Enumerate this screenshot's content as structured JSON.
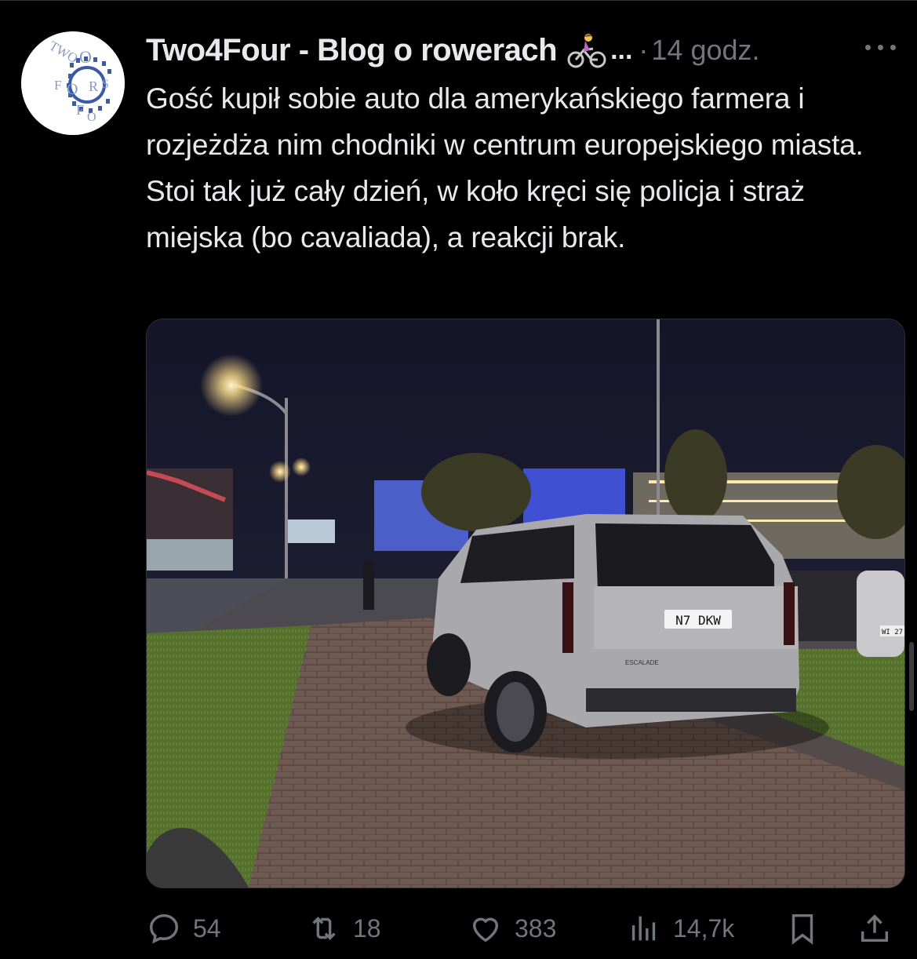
{
  "tweet": {
    "author_name": "Two4Four - Blog o rowerach",
    "ellipsis": "...",
    "separator": "·",
    "time": "14 godz.",
    "text": "Gość kupił sobie auto dla amerykańskiego farmera i rozjeżdża nim chodniki w centrum europejskiego miasta. Stoi tak już cały dzień, w koło kręci się policja i straż miejska (bo cavaliada), a reakcji brak.",
    "avatar_text": "TWO FOR FOUR",
    "emoji_icon": "cyclist-emoji-icon",
    "media": {
      "license_plate": "N7 DKW",
      "badge": "ESCALADE",
      "plate_right": "WI 27"
    }
  },
  "actions": {
    "reply_count": "54",
    "retweet_count": "18",
    "like_count": "383",
    "views_count": "14,7k"
  },
  "colors": {
    "background": "#000000",
    "text": "#e7e9ea",
    "muted": "#71767b",
    "avatar_ring": "#3b5aa6"
  }
}
